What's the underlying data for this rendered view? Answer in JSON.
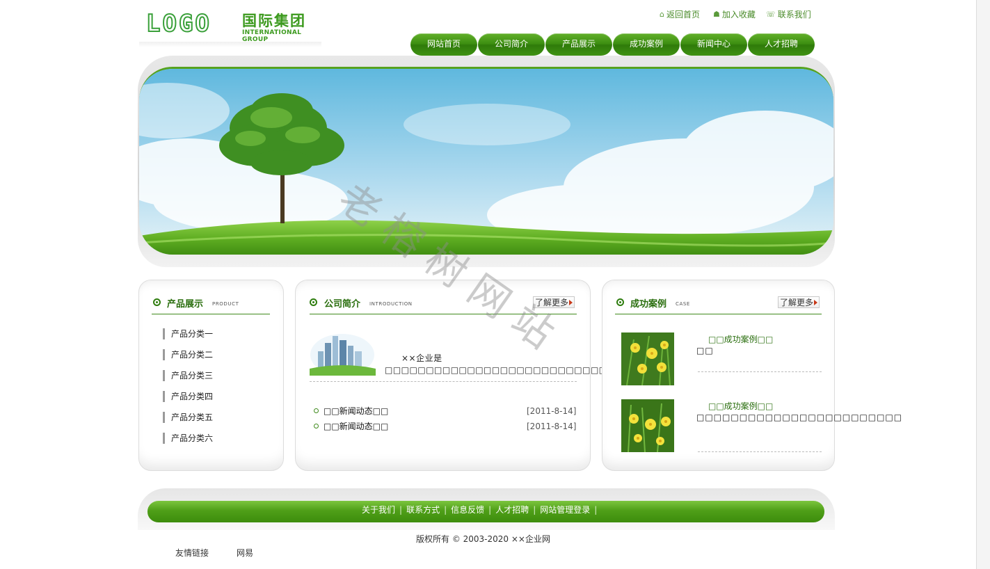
{
  "header": {
    "logo_en": "LOGO",
    "logo_cn": "国际集团",
    "logo_sub": "INTERNATIONAL GROUP",
    "top_links": [
      {
        "icon": "home-icon",
        "label": "返回首页"
      },
      {
        "icon": "favorite-icon",
        "label": "加入收藏"
      },
      {
        "icon": "contact-icon",
        "label": "联系我们"
      }
    ],
    "nav": [
      "网站首页",
      "公司简介",
      "产品展示",
      "成功案例",
      "新闻中心",
      "人才招聘"
    ]
  },
  "products": {
    "title": "产品展示",
    "title_en": "PRODUCT",
    "categories": [
      "产品分类一",
      "产品分类二",
      "产品分类三",
      "产品分类四",
      "产品分类五",
      "产品分类六"
    ]
  },
  "intro": {
    "title": "公司简介",
    "title_en": "INTRODUCTION",
    "more": "了解更多",
    "text": "××企业是□□□□□□□□□□□□□□□□□□□□□□□□□□□□□□□□□□□□□□…",
    "news": [
      {
        "title": "□□新闻动态□□",
        "date": "[2011-8-14]"
      },
      {
        "title": "□□新闻动态□□",
        "date": "[2011-8-14]"
      }
    ]
  },
  "cases": {
    "title": "成功案例",
    "title_en": "CASE",
    "more": "了解更多",
    "items": [
      {
        "title": "□□成功案例□□",
        "desc": "□□"
      },
      {
        "title": "□□成功案例□□",
        "desc": "□□□□□□□□□□□□□□□□□□□□□□□□"
      }
    ]
  },
  "footer": {
    "links": [
      "关于我们",
      "联系方式",
      "信息反馈",
      "人才招聘",
      "网站管理登录"
    ],
    "copyright": "版权所有 © 2003-2020 ××企业网",
    "friend_label": "友情链接",
    "friend_links": [
      "网易"
    ]
  },
  "watermark": "老榕树网站",
  "colors": {
    "brand_green": "#3b8d10",
    "title_green": "#2a6e0e"
  }
}
